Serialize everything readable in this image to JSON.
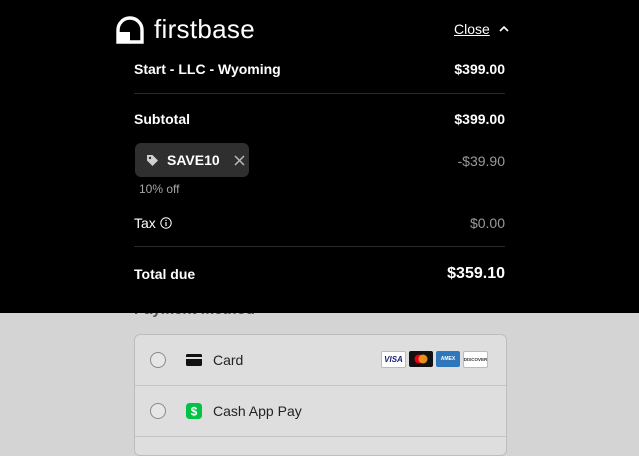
{
  "brand": {
    "name": "firstbase"
  },
  "header": {
    "close_label": "Close"
  },
  "summary": {
    "item": {
      "label": "Start - LLC - Wyoming",
      "price": "$399.00"
    },
    "subtotal": {
      "label": "Subtotal",
      "value": "$399.00"
    },
    "promo": {
      "code": "SAVE10",
      "discount": "-$39.90",
      "note": "10% off"
    },
    "tax": {
      "label": "Tax",
      "value": "$0.00"
    },
    "total": {
      "label": "Total due",
      "value": "$359.10"
    }
  },
  "payment": {
    "heading": "Payment method",
    "options": [
      {
        "label": "Card",
        "icon": "card-icon"
      },
      {
        "label": "Cash App Pay",
        "icon": "cash-app-icon"
      }
    ],
    "card_brands": [
      "VISA",
      "mastercard",
      "AMEX",
      "DISCOVER"
    ]
  },
  "colors": {
    "panel_bg": "#000000",
    "promo_bg": "#2f2f2f",
    "cash_app_green": "#00c244"
  }
}
